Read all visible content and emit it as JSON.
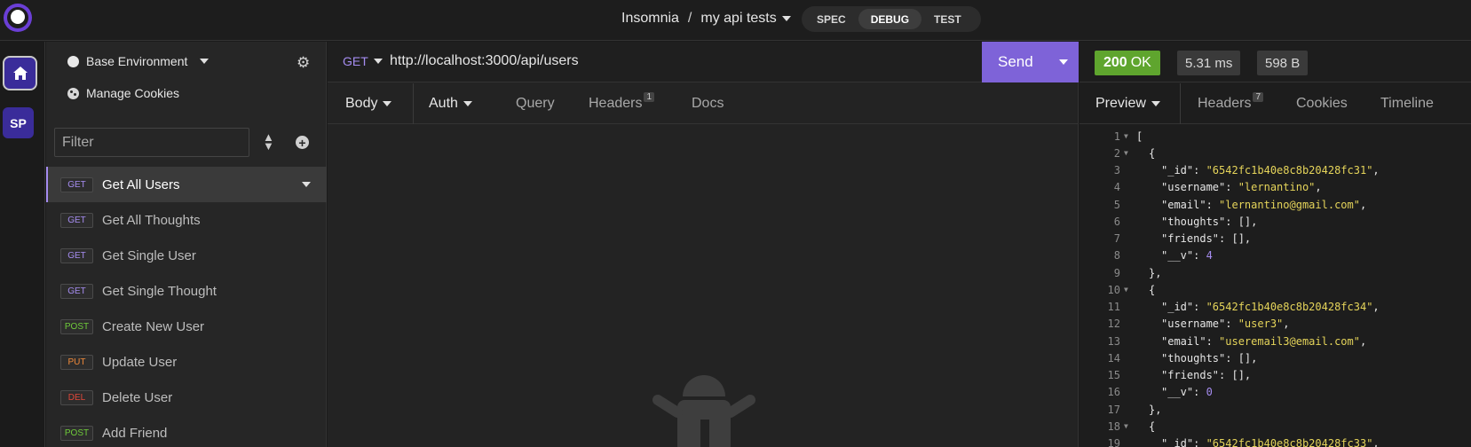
{
  "header": {
    "app_name": "Insomnia",
    "separator": "/",
    "project_name": "my api tests",
    "modes": [
      "SPEC",
      "DEBUG",
      "TEST"
    ],
    "active_mode": "DEBUG"
  },
  "rail": {
    "home_icon": "home-icon",
    "workspace_initials": "SP"
  },
  "sidebar": {
    "environment": "Base Environment",
    "manage_cookies": "Manage Cookies",
    "filter_placeholder": "Filter",
    "requests": [
      {
        "method": "GET",
        "name": "Get All Users",
        "method_color": "#a58cf0",
        "active": true
      },
      {
        "method": "GET",
        "name": "Get All Thoughts",
        "method_color": "#a58cf0"
      },
      {
        "method": "GET",
        "name": "Get Single User",
        "method_color": "#a58cf0"
      },
      {
        "method": "GET",
        "name": "Get Single Thought",
        "method_color": "#a58cf0"
      },
      {
        "method": "POST",
        "name": "Create New User",
        "method_color": "#6fcb3a"
      },
      {
        "method": "PUT",
        "name": "Update User",
        "method_color": "#f08a3a"
      },
      {
        "method": "DEL",
        "name": "Delete User",
        "method_color": "#e0483a"
      },
      {
        "method": "POST",
        "name": "Add Friend",
        "method_color": "#6fcb3a"
      }
    ]
  },
  "request": {
    "method": "GET",
    "url": "http://localhost:3000/api/users",
    "send_label": "Send",
    "tabs": {
      "body": "Body",
      "auth": "Auth",
      "query": "Query",
      "headers": "Headers",
      "headers_count": "1",
      "docs": "Docs"
    }
  },
  "response": {
    "status_code": "200",
    "status_text": "OK",
    "time": "5.31 ms",
    "size": "598 B",
    "tabs": {
      "preview": "Preview",
      "headers": "Headers",
      "headers_count": "7",
      "cookies": "Cookies",
      "timeline": "Timeline"
    },
    "body_lines": [
      {
        "n": "1",
        "fold": true,
        "indent": 0,
        "parts": [
          {
            "t": "p",
            "v": "["
          }
        ]
      },
      {
        "n": "2",
        "fold": true,
        "indent": 1,
        "parts": [
          {
            "t": "p",
            "v": "{"
          }
        ]
      },
      {
        "n": "3",
        "indent": 2,
        "parts": [
          {
            "t": "k",
            "v": "\"_id\""
          },
          {
            "t": "p",
            "v": ": "
          },
          {
            "t": "s",
            "v": "\"6542fc1b40e8c8b20428fc31\""
          },
          {
            "t": "p",
            "v": ","
          }
        ]
      },
      {
        "n": "4",
        "indent": 2,
        "parts": [
          {
            "t": "k",
            "v": "\"username\""
          },
          {
            "t": "p",
            "v": ": "
          },
          {
            "t": "s",
            "v": "\"lernantino\""
          },
          {
            "t": "p",
            "v": ","
          }
        ]
      },
      {
        "n": "5",
        "indent": 2,
        "parts": [
          {
            "t": "k",
            "v": "\"email\""
          },
          {
            "t": "p",
            "v": ": "
          },
          {
            "t": "s",
            "v": "\"lernantino@gmail.com\""
          },
          {
            "t": "p",
            "v": ","
          }
        ]
      },
      {
        "n": "6",
        "indent": 2,
        "parts": [
          {
            "t": "k",
            "v": "\"thoughts\""
          },
          {
            "t": "p",
            "v": ": [],"
          }
        ]
      },
      {
        "n": "7",
        "indent": 2,
        "parts": [
          {
            "t": "k",
            "v": "\"friends\""
          },
          {
            "t": "p",
            "v": ": [],"
          }
        ]
      },
      {
        "n": "8",
        "indent": 2,
        "parts": [
          {
            "t": "k",
            "v": "\"__v\""
          },
          {
            "t": "p",
            "v": ": "
          },
          {
            "t": "n",
            "v": "4"
          }
        ]
      },
      {
        "n": "9",
        "indent": 1,
        "parts": [
          {
            "t": "p",
            "v": "},"
          }
        ]
      },
      {
        "n": "10",
        "fold": true,
        "indent": 1,
        "parts": [
          {
            "t": "p",
            "v": "{"
          }
        ]
      },
      {
        "n": "11",
        "indent": 2,
        "parts": [
          {
            "t": "k",
            "v": "\"_id\""
          },
          {
            "t": "p",
            "v": ": "
          },
          {
            "t": "s",
            "v": "\"6542fc1b40e8c8b20428fc34\""
          },
          {
            "t": "p",
            "v": ","
          }
        ]
      },
      {
        "n": "12",
        "indent": 2,
        "parts": [
          {
            "t": "k",
            "v": "\"username\""
          },
          {
            "t": "p",
            "v": ": "
          },
          {
            "t": "s",
            "v": "\"user3\""
          },
          {
            "t": "p",
            "v": ","
          }
        ]
      },
      {
        "n": "13",
        "indent": 2,
        "parts": [
          {
            "t": "k",
            "v": "\"email\""
          },
          {
            "t": "p",
            "v": ": "
          },
          {
            "t": "s",
            "v": "\"useremail3@email.com\""
          },
          {
            "t": "p",
            "v": ","
          }
        ]
      },
      {
        "n": "14",
        "indent": 2,
        "parts": [
          {
            "t": "k",
            "v": "\"thoughts\""
          },
          {
            "t": "p",
            "v": ": [],"
          }
        ]
      },
      {
        "n": "15",
        "indent": 2,
        "parts": [
          {
            "t": "k",
            "v": "\"friends\""
          },
          {
            "t": "p",
            "v": ": [],"
          }
        ]
      },
      {
        "n": "16",
        "indent": 2,
        "parts": [
          {
            "t": "k",
            "v": "\"__v\""
          },
          {
            "t": "p",
            "v": ": "
          },
          {
            "t": "n",
            "v": "0"
          }
        ]
      },
      {
        "n": "17",
        "indent": 1,
        "parts": [
          {
            "t": "p",
            "v": "},"
          }
        ]
      },
      {
        "n": "18",
        "fold": true,
        "indent": 1,
        "parts": [
          {
            "t": "p",
            "v": "{"
          }
        ]
      },
      {
        "n": "19",
        "indent": 2,
        "parts": [
          {
            "t": "k",
            "v": "\"_id\""
          },
          {
            "t": "p",
            "v": ": "
          },
          {
            "t": "s",
            "v": "\"6542fc1b40e8c8b20428fc33\""
          },
          {
            "t": "p",
            "v": ","
          }
        ]
      }
    ]
  },
  "colors": {
    "accent": "#7e63d8",
    "status_ok": "#5fa52e",
    "string": "#e5d45a",
    "number": "#a58cf0"
  }
}
